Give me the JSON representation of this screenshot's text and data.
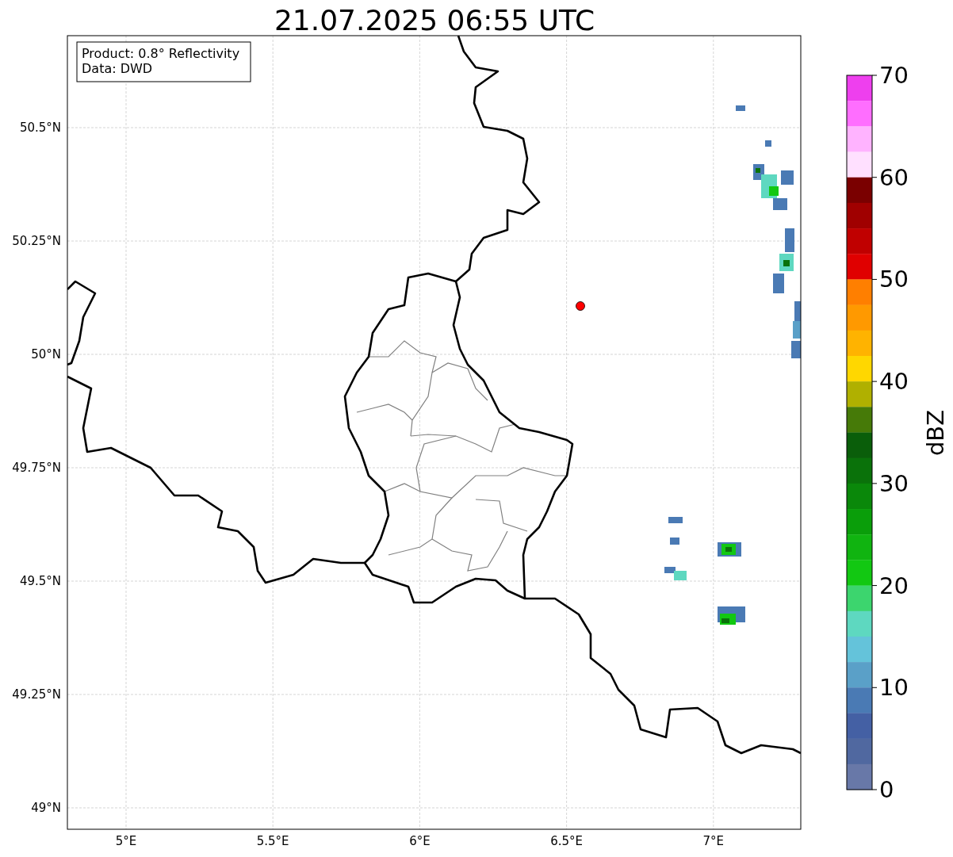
{
  "title": "21.07.2025 06:55 UTC",
  "info_box": [
    "Product: 0.8° Reflectivity",
    "Data: DWD"
  ],
  "map": {
    "lat_labels": [
      "50.5°N",
      "50.25°N",
      "50°N",
      "49.75°N",
      "49.5°N",
      "49.25°N",
      "49°N"
    ],
    "lon_labels": [
      "5°E",
      "5.5°E",
      "6°E",
      "6.5°E",
      "7°E"
    ]
  },
  "colorbar": {
    "label": "dBZ",
    "ticks": [
      "70",
      "60",
      "50",
      "40",
      "30",
      "20",
      "10",
      "0"
    ],
    "bands": [
      {
        "color": "#ee3fee"
      },
      {
        "color": "#ff6eff"
      },
      {
        "color": "#ffb3ff"
      },
      {
        "color": "#ffe0ff"
      },
      {
        "color": "#7a0000"
      },
      {
        "color": "#a00000"
      },
      {
        "color": "#c00000"
      },
      {
        "color": "#e00000"
      },
      {
        "color": "#ff7f00"
      },
      {
        "color": "#ff9900"
      },
      {
        "color": "#ffb300"
      },
      {
        "color": "#ffd700"
      },
      {
        "color": "#b0b000"
      },
      {
        "color": "#467a08"
      },
      {
        "color": "#0a5e0a"
      },
      {
        "color": "#0a720a"
      },
      {
        "color": "#0a880a"
      },
      {
        "color": "#0a9e0a"
      },
      {
        "color": "#10b410"
      },
      {
        "color": "#12c812"
      },
      {
        "color": "#3cd56e"
      },
      {
        "color": "#5ed8c0"
      },
      {
        "color": "#64c3da"
      },
      {
        "color": "#5aa0c8"
      },
      {
        "color": "#4a7ab4"
      },
      {
        "color": "#4460a4"
      },
      {
        "color": "#5068a0"
      },
      {
        "color": "#6878a8"
      }
    ]
  }
}
